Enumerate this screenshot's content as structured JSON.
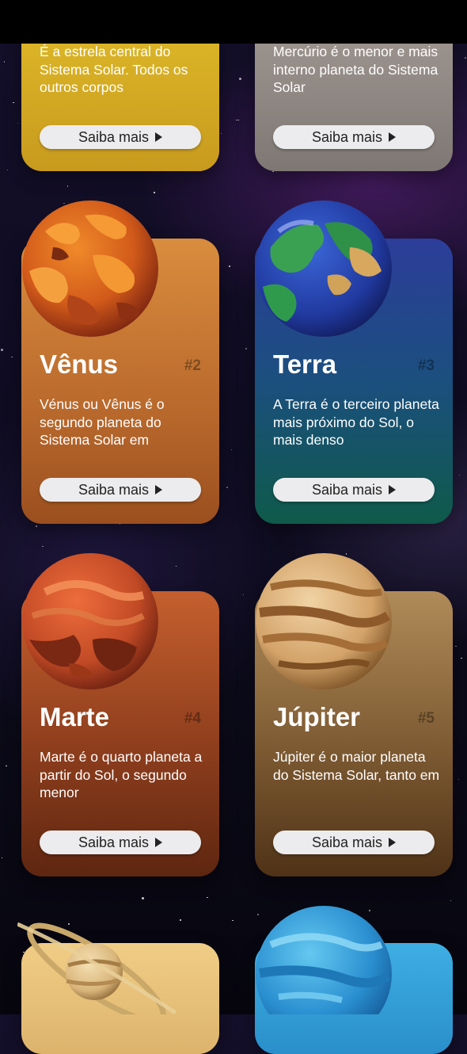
{
  "cards": [
    {
      "name": "",
      "number": "",
      "description": "É a estrela central do Sistema Solar. Todos os outros corpos",
      "button": "Saiba mais"
    },
    {
      "name": "",
      "number": "",
      "description": "Mercúrio é o menor e mais interno planeta do Sistema Solar",
      "button": "Saiba mais"
    },
    {
      "name": "Vênus",
      "number": "#2",
      "description": "Vénus ou Vênus é o segundo planeta do Sistema Solar em",
      "button": "Saiba mais"
    },
    {
      "name": "Terra",
      "number": "#3",
      "description": "A Terra é o terceiro planeta mais próximo do Sol, o mais denso",
      "button": "Saiba mais"
    },
    {
      "name": "Marte",
      "number": "#4",
      "description": "Marte é o quarto planeta a partir do Sol, o segundo menor",
      "button": "Saiba mais"
    },
    {
      "name": "Júpiter",
      "number": "#5",
      "description": "Júpiter é o maior planeta do Sistema Solar, tanto em",
      "button": "Saiba mais"
    }
  ],
  "icons": [
    "play-triangle-icon",
    "venus-planet-icon",
    "earth-planet-icon",
    "mars-planet-icon",
    "jupiter-planet-icon",
    "saturn-planet-icon",
    "neptune-planet-icon"
  ],
  "colors": {
    "sun_card": "#d8b425",
    "mercury_card": "#8d857f",
    "venus_card": "#c57b36",
    "earth_card": "#1c4c8a",
    "mars_card": "#b5552b",
    "jupiter_card": "#9d7a4c",
    "saturn_card": "#e8c27d",
    "neptune_card": "#3aa5dd"
  }
}
